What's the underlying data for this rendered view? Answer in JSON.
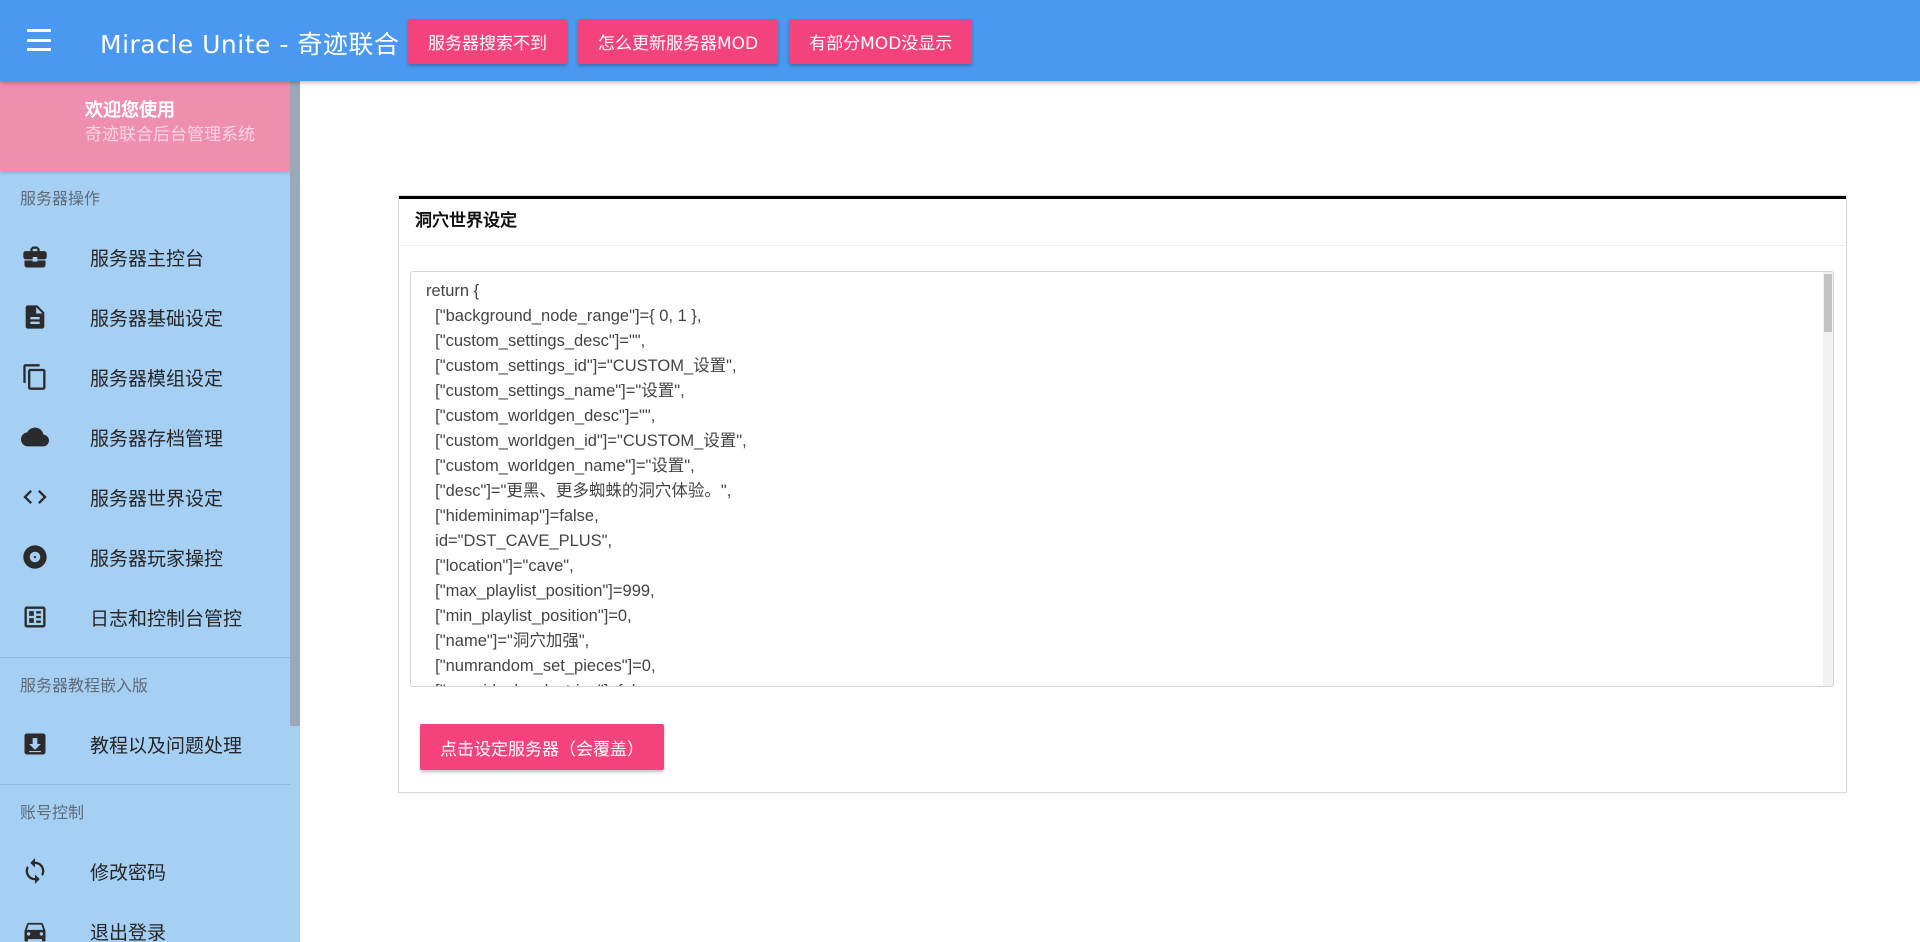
{
  "header": {
    "title": "Miracle Unite - 奇迹联合",
    "menu_icon": "hamburger-menu-icon",
    "actions": [
      {
        "label": "服务器搜索不到"
      },
      {
        "label": "怎么更新服务器MOD"
      },
      {
        "label": "有部分MOD没显示"
      }
    ],
    "accent_color": "#4a98f0",
    "button_color": "#f4437c"
  },
  "sidebar": {
    "welcome_title": "欢迎您使用",
    "welcome_subtitle": "奇迹联合后台管理系统",
    "sections": [
      {
        "header": "服务器操作",
        "items": [
          {
            "label": "服务器主控台",
            "icon": "briefcase-icon"
          },
          {
            "label": "服务器基础设定",
            "icon": "document-icon"
          },
          {
            "label": "服务器模组设定",
            "icon": "copy-icon"
          },
          {
            "label": "服务器存档管理",
            "icon": "cloud-icon"
          },
          {
            "label": "服务器世界设定",
            "icon": "code-icon"
          },
          {
            "label": "服务器玩家操控",
            "icon": "disc-icon"
          },
          {
            "label": "日志和控制台管控",
            "icon": "log-panel-icon"
          }
        ]
      },
      {
        "header": "服务器教程嵌入版",
        "items": [
          {
            "label": "教程以及问题处理",
            "icon": "download-box-icon"
          }
        ]
      },
      {
        "header": "账号控制",
        "items": [
          {
            "label": "修改密码",
            "icon": "refresh-icon"
          },
          {
            "label": "退出登录",
            "icon": "car-icon"
          }
        ]
      }
    ]
  },
  "card": {
    "title": "洞穴世界设定",
    "code_lines": [
      "return {",
      "  [\"background_node_range\"]={ 0, 1 },",
      "  [\"custom_settings_desc\"]=\"\",",
      "  [\"custom_settings_id\"]=\"CUSTOM_设置\",",
      "  [\"custom_settings_name\"]=\"设置\",",
      "  [\"custom_worldgen_desc\"]=\"\",",
      "  [\"custom_worldgen_id\"]=\"CUSTOM_设置\",",
      "  [\"custom_worldgen_name\"]=\"设置\",",
      "  [\"desc\"]=\"更黑、更多蜘蛛的洞穴体验。\",",
      "  [\"hideminimap\"]=false,",
      "  id=\"DST_CAVE_PLUS\",",
      "  [\"location\"]=\"cave\",",
      "  [\"max_playlist_position\"]=999,",
      "  [\"min_playlist_position\"]=0,",
      "  [\"name\"]=\"洞穴加强\",",
      "  [\"numrandom_set_pieces\"]=0,",
      "  [\"override_level_string\"]=false,"
    ],
    "submit_label": "点击设定服务器（会覆盖）"
  }
}
